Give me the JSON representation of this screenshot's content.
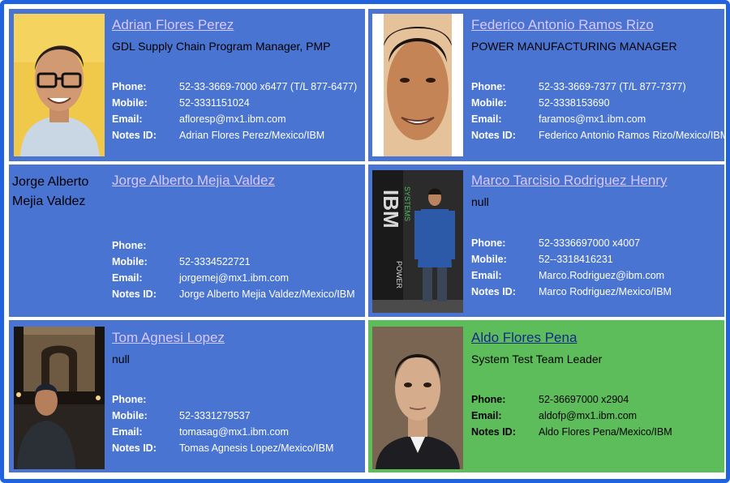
{
  "labels": {
    "phone": "Phone:",
    "mobile": "Mobile:",
    "email": "Email:",
    "notes": "Notes ID:"
  },
  "contacts": [
    {
      "name": "Adrian Flores Perez",
      "title": "GDL Supply Chain Program Manager, PMP",
      "phone": "52-33-3669-7000 x6477 (T/L 877-6477)",
      "mobile": "52-3331151024",
      "email": "afloresp@mx1.ibm.com",
      "notes": "Adrian Flores Perez/Mexico/IBM"
    },
    {
      "name": "Federico Antonio Ramos Rizo",
      "title": "POWER MANUFACTURING MANAGER",
      "phone": "52-33-3669-7377 (T/L 877-7377)",
      "mobile": "52-3338153690",
      "email": "faramos@mx1.ibm.com",
      "notes": "Federico Antonio Ramos Rizo/Mexico/IBM"
    },
    {
      "name": "Jorge Alberto Mejia Valdez",
      "photo_alt": "Jorge Alberto Mejia Valdez",
      "phone": "",
      "mobile": "52-3334522721",
      "email": "jorgemej@mx1.ibm.com",
      "notes": "Jorge Alberto Mejia Valdez/Mexico/IBM"
    },
    {
      "name": "Marco Tarcisio Rodriguez Henry",
      "title": "null",
      "phone": "52-3336697000 x4007",
      "mobile": "52--3318416231",
      "email": "Marco.Rodriguez@ibm.com",
      "notes": "Marco Rodriguez/Mexico/IBM",
      "banner_brand": "IBM",
      "banner_text_1": "POWER",
      "banner_text_2": "SYSTEMS"
    },
    {
      "name": "Tom Agnesi Lopez",
      "title": "null",
      "phone": "",
      "mobile": "52-3331279537",
      "email": "tomasag@mx1.ibm.com",
      "notes": "Tomas Agnesis Lopez/Mexico/IBM"
    },
    {
      "name": "Aldo Flores Pena",
      "title": "System Test Team Leader",
      "phone": "52-36697000 x2904",
      "email": "aldofp@mx1.ibm.com",
      "notes": "Aldo Flores Pena/Mexico/IBM"
    }
  ],
  "colors": {
    "frame": "#1f63e0",
    "card_blue": "#4a74d2",
    "card_highlight": "#5cbd5a",
    "name_link": "#d9c7ff"
  }
}
